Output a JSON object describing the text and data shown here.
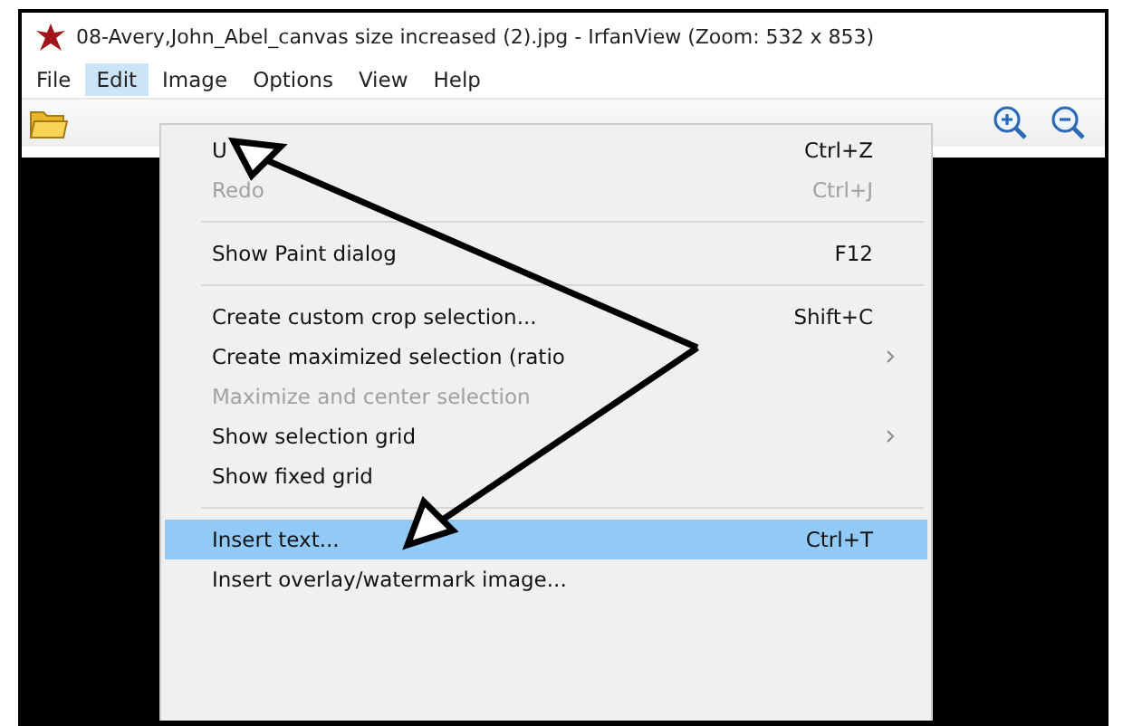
{
  "window": {
    "title": "08-Avery,John_Abel_canvas size increased (2).jpg - IrfanView (Zoom: 532 x 853)"
  },
  "menu_bar": [
    {
      "label": "File",
      "selected": false
    },
    {
      "label": "Edit",
      "selected": true
    },
    {
      "label": "Image",
      "selected": false
    },
    {
      "label": "Options",
      "selected": false
    },
    {
      "label": "View",
      "selected": false
    },
    {
      "label": "Help",
      "selected": false
    }
  ],
  "edit_menu": [
    {
      "kind": "item",
      "label": "U",
      "shortcut": "Ctrl+Z",
      "disabled": false,
      "selected": false,
      "submenu": false
    },
    {
      "kind": "item",
      "label": "Redo",
      "shortcut": "Ctrl+J",
      "disabled": true,
      "selected": false,
      "submenu": false
    },
    {
      "kind": "separator"
    },
    {
      "kind": "item",
      "label": "Show Paint dialog",
      "shortcut": "F12",
      "disabled": false,
      "selected": false,
      "submenu": false
    },
    {
      "kind": "separator"
    },
    {
      "kind": "item",
      "label": "Create custom crop selection...",
      "shortcut": "Shift+C",
      "disabled": false,
      "selected": false,
      "submenu": false
    },
    {
      "kind": "item",
      "label": "Create maximized selection (ratio",
      "disabled": false,
      "selected": false,
      "submenu": true
    },
    {
      "kind": "item",
      "label": "Maximize and center selection",
      "disabled": true,
      "selected": false,
      "submenu": false
    },
    {
      "kind": "item",
      "label": "Show selection grid",
      "disabled": false,
      "selected": false,
      "submenu": true
    },
    {
      "kind": "item",
      "label": "Show fixed grid",
      "disabled": false,
      "selected": false,
      "submenu": false
    },
    {
      "kind": "separator"
    },
    {
      "kind": "item",
      "label": "Insert text...",
      "shortcut": "Ctrl+T",
      "disabled": false,
      "selected": true,
      "submenu": false
    },
    {
      "kind": "item",
      "label": "Insert overlay/watermark image...",
      "disabled": false,
      "selected": false,
      "submenu": false
    }
  ]
}
